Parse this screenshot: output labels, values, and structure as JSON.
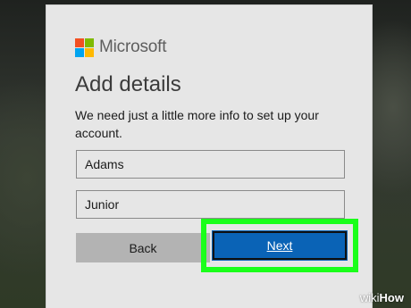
{
  "brand": {
    "name": "Microsoft",
    "logo_colors": [
      "#f25022",
      "#7fba00",
      "#00a4ef",
      "#ffb900"
    ]
  },
  "page": {
    "title": "Add details",
    "description": "We need just a little more info to set up your account."
  },
  "fields": {
    "last_name_value": "Adams",
    "first_name_value": "Junior"
  },
  "buttons": {
    "back_label": "Back",
    "next_label": "Next"
  },
  "highlight_color": "#1aff1a",
  "accent_color": "#0a63b6",
  "watermark": {
    "prefix": "wiki",
    "suffix": "How"
  }
}
